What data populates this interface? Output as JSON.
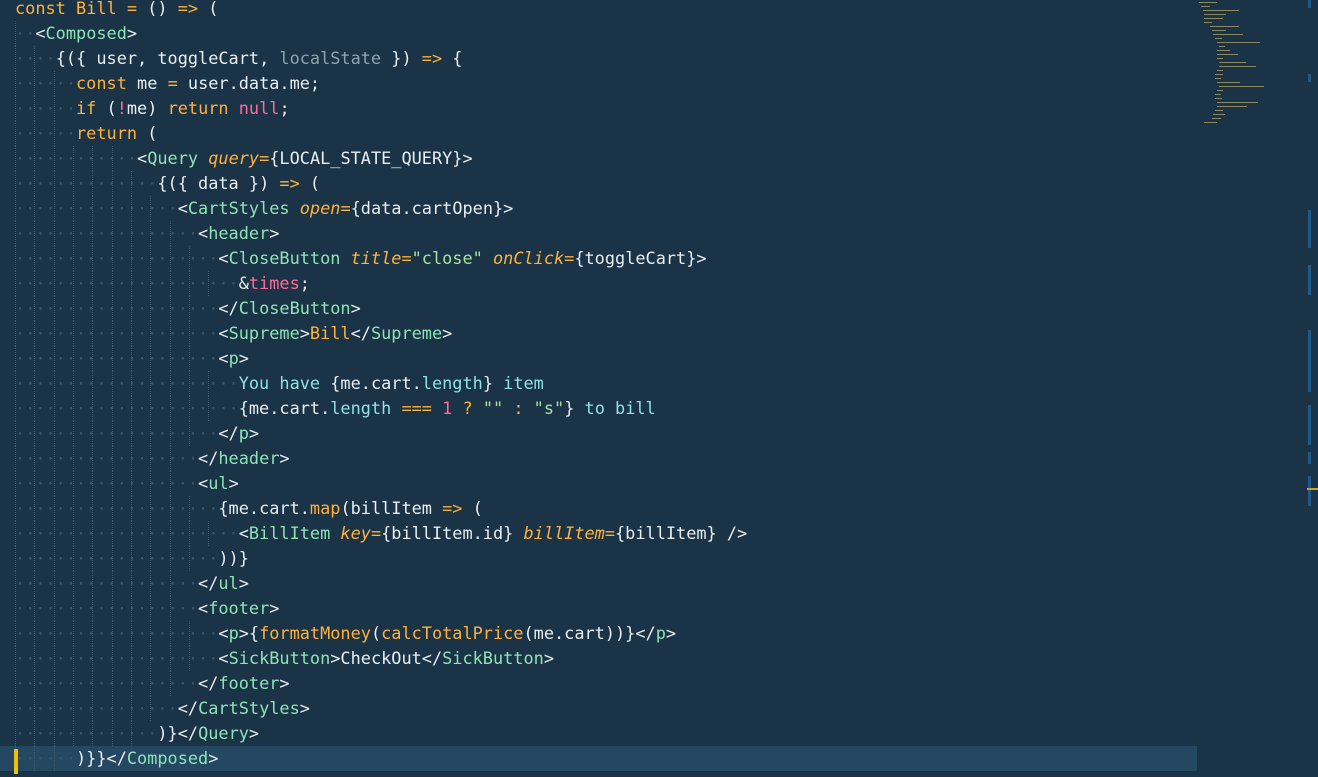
{
  "editor": {
    "language": "javascript-jsx",
    "current_line_index": 30,
    "lines": [
      "const Bill = () => (",
      "  <Composed>",
      "    {({ user, toggleCart, localState }) => {",
      "      const me = user.data.me;",
      "      if (!me) return null;",
      "      return (",
      "            <Query query={LOCAL_STATE_QUERY}>",
      "              {({ data }) => (",
      "                <CartStyles open={data.cartOpen}>",
      "                  <header>",
      "                    <CloseButton title=\"close\" onClick={toggleCart}>",
      "                      &times;",
      "                    </CloseButton>",
      "                    <Supreme>Bill</Supreme>",
      "                    <p>",
      "                      You have {me.cart.length} item",
      "                      {me.cart.length === 1 ? \"\" : \"s\"} to bill",
      "                    </p>",
      "                  </header>",
      "                  <ul>",
      "                    {me.cart.map(billItem => (",
      "                      <BillItem key={billItem.id} billItem={billItem} />",
      "                    ))}",
      "                  </ul>",
      "                  <footer>",
      "                    <p>{formatMoney(calcTotalPrice(me.cart))}</p>",
      "                    <SickButton>CheckOut</SickButton>",
      "                  </footer>",
      "                </CartStyles>",
      "              )}</Query>",
      "      )}}</Composed>"
    ]
  },
  "colors": {
    "background": "#1b3346",
    "current_line": "#254862",
    "keyword": "#ffb13b",
    "tag": "#8ee3b5",
    "string": "#a6e3a0",
    "number": "#ff6a9a",
    "cursor_gutter_marker": "#f2c200"
  }
}
